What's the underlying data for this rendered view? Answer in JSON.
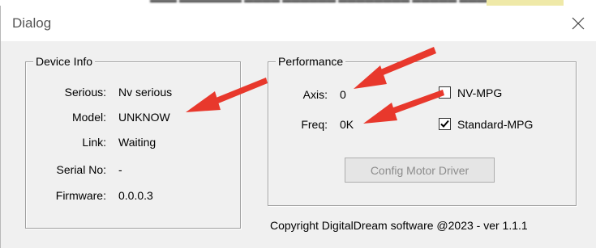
{
  "window": {
    "title": "Dialog"
  },
  "device_info": {
    "legend": "Device Info",
    "rows": [
      {
        "label": "Serious:",
        "value": "Nv serious"
      },
      {
        "label": "Model:",
        "value": "UNKNOW"
      },
      {
        "label": "Link:",
        "value": "Waiting"
      },
      {
        "label": "Serial No:",
        "value": "-"
      },
      {
        "label": "Firmware:",
        "value": "0.0.0.3"
      }
    ]
  },
  "performance": {
    "legend": "Performance",
    "axis_label": "Axis:",
    "axis_value": "0",
    "freq_label": "Freq:",
    "freq_value": "0K",
    "nv_mpg": {
      "label": "NV-MPG",
      "checked": false
    },
    "standard_mpg": {
      "label": "Standard-MPG",
      "checked": true
    },
    "config_button": "Config Motor Driver",
    "config_button_enabled": false
  },
  "footer": "Copyright DigitalDream software @2023 - ver 1.1.1",
  "colors": {
    "annotation_arrow": "#e8382c",
    "disabled_text": "#8c8c8c",
    "background": "#f0f0f0"
  },
  "icons": [
    "close-icon",
    "checkmark-icon",
    "annotation-arrow-icon"
  ]
}
